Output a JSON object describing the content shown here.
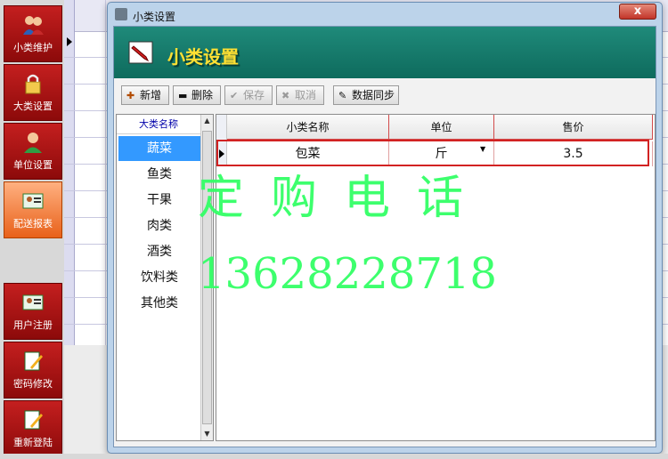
{
  "dialog": {
    "title": "小类设置",
    "banner_title": "小类设置",
    "close_label": "x"
  },
  "left_nav": [
    {
      "label": "小类维护",
      "icon": "users-icon",
      "active": false
    },
    {
      "label": "大类设置",
      "icon": "lock-icon",
      "active": false
    },
    {
      "label": "单位设置",
      "icon": "user-icon",
      "active": false
    },
    {
      "label": "配送报表",
      "icon": "contact-card-icon",
      "active": true
    },
    {
      "label": "用户注册",
      "icon": "contact-card-icon",
      "active": false
    },
    {
      "label": "密码修改",
      "icon": "notepad-icon",
      "active": false
    },
    {
      "label": "重新登陆",
      "icon": "notepad-icon",
      "active": false
    }
  ],
  "toolbar": {
    "add": "新增",
    "delete": "删除",
    "save": "保存",
    "cancel": "取消",
    "sync": "数据同步"
  },
  "category_list": {
    "header": "大类名称",
    "items": [
      "蔬菜",
      "鱼类",
      "干果",
      "肉类",
      "酒类",
      "饮料类",
      "其他类"
    ],
    "selected": "蔬菜"
  },
  "sub_grid": {
    "columns": [
      "小类名称",
      "单位",
      "售价"
    ],
    "rows": [
      {
        "name": "包菜",
        "unit": "斤",
        "price": "3.5"
      }
    ]
  },
  "watermark": {
    "line1": "定购电话",
    "line2": "13628228718"
  },
  "colors": {
    "banner": "#0e6b5d",
    "banner_text": "#ffe033",
    "nav_red": "#c41f1f",
    "nav_active": "#e8611a",
    "selection": "#3399ff",
    "watermark": "#33ff66"
  }
}
